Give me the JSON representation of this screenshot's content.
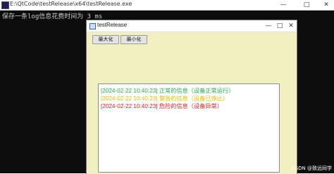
{
  "console": {
    "title": "E:\\QtCode\\testRelease\\x64\\testRelease.exe",
    "output_line": "保存一条log信息花费时间为 3 ms",
    "controls": {
      "minimize": "—",
      "maximize": "□",
      "close": "✕"
    }
  },
  "app": {
    "title": "testRelease",
    "controls": {
      "minimize": "—",
      "maximize": "□",
      "close": "✕"
    },
    "buttons": {
      "maximize_label": "最大化",
      "minimize_label": "最小化"
    },
    "log_lines": [
      {
        "text": "[2024-02-22 10:40:23] 正常的信息（设备正常运行）",
        "color": "#22b04a"
      },
      {
        "text": "[2024-02-22 10:40:23] 警告的信息（设备已停止）",
        "color": "#e6b800"
      },
      {
        "text": "[2024-02-22 10:40:23] 危险的信息（设备异常）",
        "color": "#e02020"
      }
    ]
  },
  "watermark": "CSDN @致远同学"
}
